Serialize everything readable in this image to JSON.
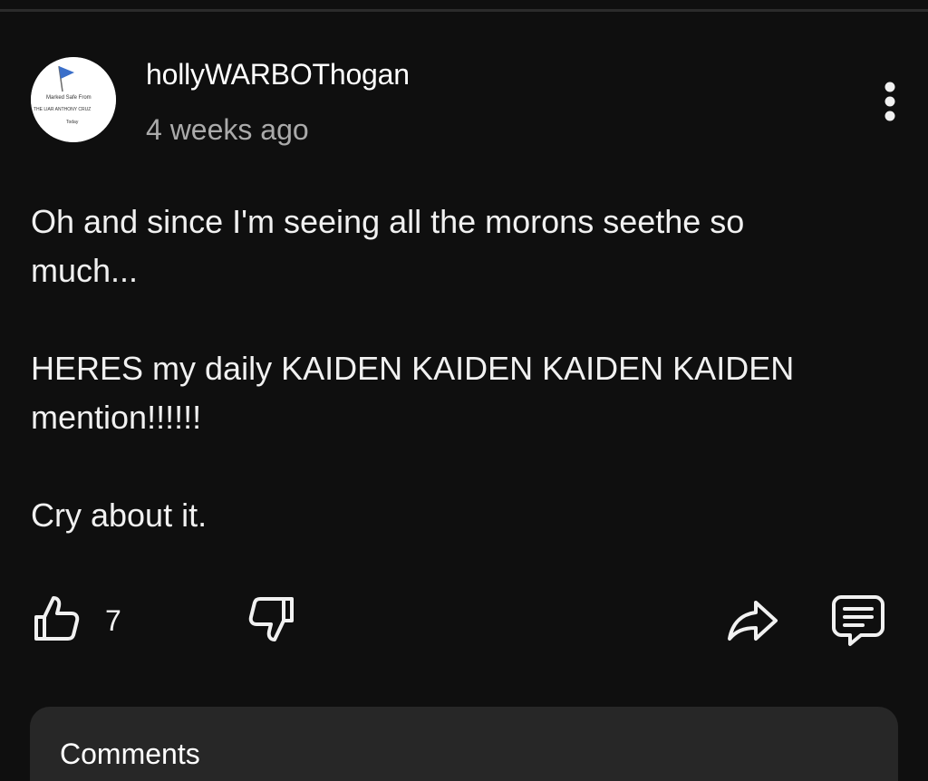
{
  "colors": {
    "background": "#0f0f0f",
    "primary_text": "#f1f1f1",
    "secondary_text": "#aaaaaa",
    "card_background": "#272727",
    "avatar_flag": "#3b6fc9"
  },
  "post": {
    "author": "hollyWARBOThogan",
    "timestamp": "4 weeks ago",
    "avatar": {
      "icon": "blue-flag-icon",
      "line1": "Marked Safe From",
      "line2": "THE LIAR ANTHONY CRUZ",
      "line3": "Today"
    },
    "menu_icon": "kebab-menu-icon",
    "body": {
      "line1": "Oh and since I'm seeing all the morons seethe so",
      "line2": "much...",
      "line3": "HERES my daily KAIDEN KAIDEN KAIDEN KAIDEN",
      "line4": "mention!!!!!!",
      "line5": "Cry about it."
    }
  },
  "actions": {
    "like_icon": "thumbs-up-icon",
    "like_count": "7",
    "dislike_icon": "thumbs-down-icon",
    "share_icon": "share-icon",
    "reply_icon": "comment-icon"
  },
  "comments": {
    "title": "Comments"
  }
}
